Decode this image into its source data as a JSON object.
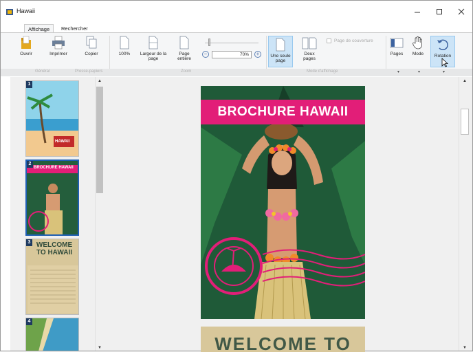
{
  "window": {
    "title": "Hawaii"
  },
  "tabs": [
    {
      "label": "Affichage"
    },
    {
      "label": "Rechercher"
    }
  ],
  "ribbon": {
    "open_label": "Ouvrir",
    "print_label": "Imprimer",
    "copy_label": "Copier",
    "zoom100_label": "100%",
    "page_width_label": "Largeur de la page",
    "whole_page_label": "Page entière",
    "zoom_value": "70%",
    "single_page_label": "Une seule page",
    "two_pages_label": "Deux pages",
    "cover_page_label": "Page de couverture",
    "pages_label": "Pages",
    "mode_label": "Mode",
    "rotation_label": "Rotation",
    "groups": {
      "general": "Général",
      "clipboard": "Presse-papiers",
      "zoom": "Zoom",
      "display_mode": "Mode d'affichage"
    }
  },
  "thumbnails": [
    {
      "number": "1",
      "text": "HAWAII"
    },
    {
      "number": "2",
      "text": "BROCHURE HAWAII"
    },
    {
      "number": "3",
      "text": "WELCOME TO HAWAII"
    },
    {
      "number": "4",
      "text": ""
    }
  ],
  "document": {
    "page1_banner": "BROCHURE HAWAII",
    "page2_heading": "WELCOME TO"
  },
  "colors": {
    "accent_pink": "#e21e78",
    "selection_blue": "#1e5fb4",
    "ribbon_active": "#cce4f7"
  }
}
